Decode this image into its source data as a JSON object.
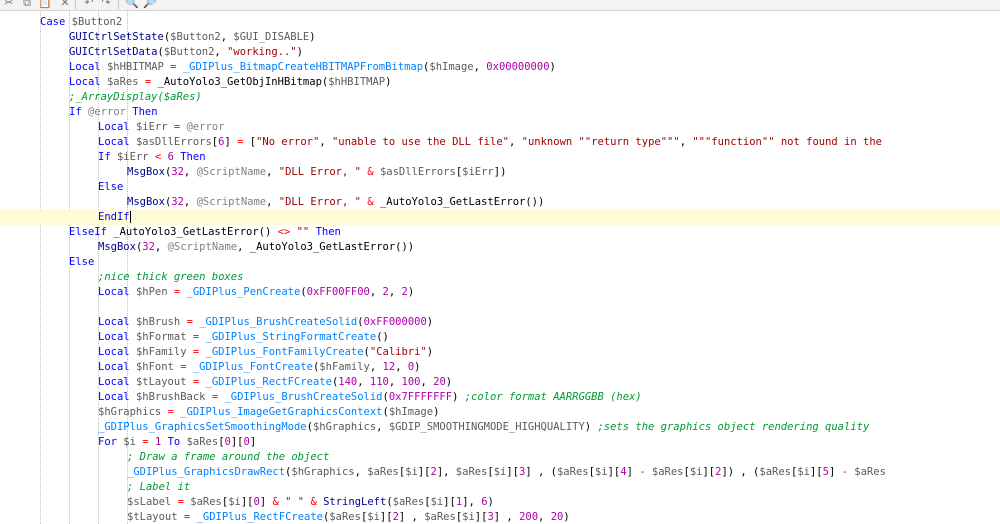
{
  "toolbar": {
    "icons": [
      "cut-icon",
      "copy-icon",
      "paste-icon",
      "delete-icon",
      "undo-icon",
      "redo-icon",
      "find-icon",
      "find-replace-icon"
    ],
    "glyphs": [
      "✂",
      "⧉",
      "📋",
      "✕",
      "↶",
      "↷",
      "🔍",
      "🔎"
    ]
  },
  "editor": {
    "lines": [
      [
        [
          "kw",
          "Case"
        ],
        [
          "t",
          " "
        ],
        [
          "var",
          "$Button2"
        ]
      ],
      [
        [
          "fn",
          "GUICtrlSetState"
        ],
        [
          "t",
          "("
        ],
        [
          "var",
          "$Button2"
        ],
        [
          "t",
          ", "
        ],
        [
          "var",
          "$GUI_DISABLE"
        ],
        [
          "t",
          ")"
        ]
      ],
      [
        [
          "fn",
          "GUICtrlSetData"
        ],
        [
          "t",
          "("
        ],
        [
          "var",
          "$Button2"
        ],
        [
          "t",
          ", "
        ],
        [
          "str",
          "\"working..\""
        ],
        [
          "t",
          ")"
        ]
      ],
      [
        [
          "kw",
          "Local"
        ],
        [
          "t",
          " "
        ],
        [
          "var",
          "$hHBITMAP"
        ],
        [
          "t",
          " "
        ],
        [
          "op",
          "="
        ],
        [
          "t",
          " "
        ],
        [
          "udf",
          "_GDIPlus_BitmapCreateHBITMAPFromBitmap"
        ],
        [
          "t",
          "("
        ],
        [
          "var",
          "$hImage"
        ],
        [
          "t",
          ", "
        ],
        [
          "num",
          "0x00000000"
        ],
        [
          "t",
          ")"
        ]
      ],
      [
        [
          "kw",
          "Local"
        ],
        [
          "t",
          " "
        ],
        [
          "var",
          "$aRes"
        ],
        [
          "t",
          " "
        ],
        [
          "op",
          "="
        ],
        [
          "t",
          " _AutoYolo3_GetObjInHBitmap("
        ],
        [
          "var",
          "$hHBITMAP"
        ],
        [
          "t",
          ")"
        ]
      ],
      [
        [
          "cm",
          ";_ArrayDisplay($aRes)"
        ]
      ],
      [
        [
          "kw",
          "If"
        ],
        [
          "t",
          " "
        ],
        [
          "mac",
          "@error"
        ],
        [
          "t",
          " "
        ],
        [
          "kw",
          "Then"
        ]
      ],
      [
        [
          "kw",
          "Local"
        ],
        [
          "t",
          " "
        ],
        [
          "var",
          "$iErr"
        ],
        [
          "t",
          " "
        ],
        [
          "op",
          "="
        ],
        [
          "t",
          " "
        ],
        [
          "mac",
          "@error"
        ]
      ],
      [
        [
          "kw",
          "Local"
        ],
        [
          "t",
          " "
        ],
        [
          "var",
          "$asDllErrors"
        ],
        [
          "t",
          "["
        ],
        [
          "num",
          "6"
        ],
        [
          "t",
          "] "
        ],
        [
          "op",
          "="
        ],
        [
          "t",
          " ["
        ],
        [
          "str",
          "\"No error\""
        ],
        [
          "t",
          ", "
        ],
        [
          "str",
          "\"unable to use the DLL file\""
        ],
        [
          "t",
          ", "
        ],
        [
          "str",
          "\"unknown \"\"return type\"\"\""
        ],
        [
          "t",
          ", "
        ],
        [
          "str",
          "\"\"\"function\"\" not found in the"
        ]
      ],
      [
        [
          "kw",
          "If"
        ],
        [
          "t",
          " "
        ],
        [
          "var",
          "$iErr"
        ],
        [
          "t",
          " "
        ],
        [
          "op",
          "<"
        ],
        [
          "t",
          " "
        ],
        [
          "num",
          "6"
        ],
        [
          "t",
          " "
        ],
        [
          "kw",
          "Then"
        ]
      ],
      [
        [
          "fn",
          "MsgBox"
        ],
        [
          "t",
          "("
        ],
        [
          "num",
          "32"
        ],
        [
          "t",
          ", "
        ],
        [
          "mac",
          "@ScriptName"
        ],
        [
          "t",
          ", "
        ],
        [
          "str",
          "\"DLL Error, \""
        ],
        [
          "t",
          " "
        ],
        [
          "op",
          "&"
        ],
        [
          "t",
          " "
        ],
        [
          "var",
          "$asDllErrors"
        ],
        [
          "t",
          "["
        ],
        [
          "var",
          "$iErr"
        ],
        [
          "t",
          "])"
        ]
      ],
      [
        [
          "kw",
          "Else"
        ]
      ],
      [
        [
          "fn",
          "MsgBox"
        ],
        [
          "t",
          "("
        ],
        [
          "num",
          "32"
        ],
        [
          "t",
          ", "
        ],
        [
          "mac",
          "@ScriptName"
        ],
        [
          "t",
          ", "
        ],
        [
          "str",
          "\"DLL Error, \""
        ],
        [
          "t",
          " "
        ],
        [
          "op",
          "&"
        ],
        [
          "t",
          " _AutoYolo3_GetLastError())"
        ]
      ],
      [
        [
          "kw",
          "EndIf"
        ]
      ],
      [
        [
          "kw",
          "ElseIf"
        ],
        [
          "t",
          " _AutoYolo3_GetLastError() "
        ],
        [
          "op",
          "<>"
        ],
        [
          "t",
          " "
        ],
        [
          "str",
          "\"\""
        ],
        [
          "t",
          " "
        ],
        [
          "kw",
          "Then"
        ]
      ],
      [
        [
          "fn",
          "MsgBox"
        ],
        [
          "t",
          "("
        ],
        [
          "num",
          "32"
        ],
        [
          "t",
          ", "
        ],
        [
          "mac",
          "@ScriptName"
        ],
        [
          "t",
          ", _AutoYolo3_GetLastError())"
        ]
      ],
      [
        [
          "kw",
          "Else"
        ]
      ],
      [
        [
          "cm",
          ";nice thick green boxes"
        ]
      ],
      [
        [
          "kw",
          "Local"
        ],
        [
          "t",
          " "
        ],
        [
          "var",
          "$hPen"
        ],
        [
          "t",
          " "
        ],
        [
          "op",
          "="
        ],
        [
          "t",
          " "
        ],
        [
          "udf",
          "_GDIPlus_PenCreate"
        ],
        [
          "t",
          "("
        ],
        [
          "num",
          "0xFF00FF00"
        ],
        [
          "t",
          ", "
        ],
        [
          "num",
          "2"
        ],
        [
          "t",
          ", "
        ],
        [
          "num",
          "2"
        ],
        [
          "t",
          ")"
        ]
      ],
      [],
      [
        [
          "kw",
          "Local"
        ],
        [
          "t",
          " "
        ],
        [
          "var",
          "$hBrush"
        ],
        [
          "t",
          " "
        ],
        [
          "op",
          "="
        ],
        [
          "t",
          " "
        ],
        [
          "udf",
          "_GDIPlus_BrushCreateSolid"
        ],
        [
          "t",
          "("
        ],
        [
          "num",
          "0xFF000000"
        ],
        [
          "t",
          ")"
        ]
      ],
      [
        [
          "kw",
          "Local"
        ],
        [
          "t",
          " "
        ],
        [
          "var",
          "$hFormat"
        ],
        [
          "t",
          " "
        ],
        [
          "op",
          "="
        ],
        [
          "t",
          " "
        ],
        [
          "udf",
          "_GDIPlus_StringFormatCreate"
        ],
        [
          "t",
          "()"
        ]
      ],
      [
        [
          "kw",
          "Local"
        ],
        [
          "t",
          " "
        ],
        [
          "var",
          "$hFamily"
        ],
        [
          "t",
          " "
        ],
        [
          "op",
          "="
        ],
        [
          "t",
          " "
        ],
        [
          "udf",
          "_GDIPlus_FontFamilyCreate"
        ],
        [
          "t",
          "("
        ],
        [
          "str",
          "\"Calibri\""
        ],
        [
          "t",
          ")"
        ]
      ],
      [
        [
          "kw",
          "Local"
        ],
        [
          "t",
          " "
        ],
        [
          "var",
          "$hFont"
        ],
        [
          "t",
          " "
        ],
        [
          "op",
          "="
        ],
        [
          "t",
          " "
        ],
        [
          "udf",
          "_GDIPlus_FontCreate"
        ],
        [
          "t",
          "("
        ],
        [
          "var",
          "$hFamily"
        ],
        [
          "t",
          ", "
        ],
        [
          "num",
          "12"
        ],
        [
          "t",
          ", "
        ],
        [
          "num",
          "0"
        ],
        [
          "t",
          ")"
        ]
      ],
      [
        [
          "kw",
          "Local"
        ],
        [
          "t",
          " "
        ],
        [
          "var",
          "$tLayout"
        ],
        [
          "t",
          " "
        ],
        [
          "op",
          "="
        ],
        [
          "t",
          " "
        ],
        [
          "udf",
          "_GDIPlus_RectFCreate"
        ],
        [
          "t",
          "("
        ],
        [
          "num",
          "140"
        ],
        [
          "t",
          ", "
        ],
        [
          "num",
          "110"
        ],
        [
          "t",
          ", "
        ],
        [
          "num",
          "100"
        ],
        [
          "t",
          ", "
        ],
        [
          "num",
          "20"
        ],
        [
          "t",
          ")"
        ]
      ],
      [
        [
          "kw",
          "Local"
        ],
        [
          "t",
          " "
        ],
        [
          "var",
          "$hBrushBack"
        ],
        [
          "t",
          " "
        ],
        [
          "op",
          "="
        ],
        [
          "t",
          " "
        ],
        [
          "udf",
          "_GDIPlus_BrushCreateSolid"
        ],
        [
          "t",
          "("
        ],
        [
          "num",
          "0x7FFFFFFF"
        ],
        [
          "t",
          ") "
        ],
        [
          "cm",
          ";color format AARRGGBB (hex)"
        ]
      ],
      [
        [
          "var",
          "$hGraphics"
        ],
        [
          "t",
          " "
        ],
        [
          "op",
          "="
        ],
        [
          "t",
          " "
        ],
        [
          "udf",
          "_GDIPlus_ImageGetGraphicsContext"
        ],
        [
          "t",
          "("
        ],
        [
          "var",
          "$hImage"
        ],
        [
          "t",
          ")"
        ]
      ],
      [
        [
          "udf",
          "_GDIPlus_GraphicsSetSmoothingMode"
        ],
        [
          "t",
          "("
        ],
        [
          "var",
          "$hGraphics"
        ],
        [
          "t",
          ", "
        ],
        [
          "var",
          "$GDIP_SMOOTHINGMODE_HIGHQUALITY"
        ],
        [
          "t",
          ") "
        ],
        [
          "cm",
          ";sets the graphics object rendering quality"
        ]
      ],
      [
        [
          "kw",
          "For"
        ],
        [
          "t",
          " "
        ],
        [
          "var",
          "$i"
        ],
        [
          "t",
          " "
        ],
        [
          "op",
          "="
        ],
        [
          "t",
          " "
        ],
        [
          "num",
          "1"
        ],
        [
          "t",
          " "
        ],
        [
          "kw",
          "To"
        ],
        [
          "t",
          " "
        ],
        [
          "var",
          "$aRes"
        ],
        [
          "t",
          "["
        ],
        [
          "num",
          "0"
        ],
        [
          "t",
          "]["
        ],
        [
          "num",
          "0"
        ],
        [
          "t",
          "]"
        ]
      ],
      [
        [
          "cm",
          "; Draw a frame around the object"
        ]
      ],
      [
        [
          "udf",
          "_GDIPlus_GraphicsDrawRect"
        ],
        [
          "t",
          "("
        ],
        [
          "var",
          "$hGraphics"
        ],
        [
          "t",
          ", "
        ],
        [
          "var",
          "$aRes"
        ],
        [
          "t",
          "["
        ],
        [
          "var",
          "$i"
        ],
        [
          "t",
          "]["
        ],
        [
          "num",
          "2"
        ],
        [
          "t",
          "], "
        ],
        [
          "var",
          "$aRes"
        ],
        [
          "t",
          "["
        ],
        [
          "var",
          "$i"
        ],
        [
          "t",
          "]["
        ],
        [
          "num",
          "3"
        ],
        [
          "t",
          "] , ("
        ],
        [
          "var",
          "$aRes"
        ],
        [
          "t",
          "["
        ],
        [
          "var",
          "$i"
        ],
        [
          "t",
          "]["
        ],
        [
          "num",
          "4"
        ],
        [
          "t",
          "] "
        ],
        [
          "op",
          "-"
        ],
        [
          "t",
          " "
        ],
        [
          "var",
          "$aRes"
        ],
        [
          "t",
          "["
        ],
        [
          "var",
          "$i"
        ],
        [
          "t",
          "]["
        ],
        [
          "num",
          "2"
        ],
        [
          "t",
          "]) , ("
        ],
        [
          "var",
          "$aRes"
        ],
        [
          "t",
          "["
        ],
        [
          "var",
          "$i"
        ],
        [
          "t",
          "]["
        ],
        [
          "num",
          "5"
        ],
        [
          "t",
          "] "
        ],
        [
          "op",
          "-"
        ],
        [
          "t",
          " "
        ],
        [
          "var",
          "$aRes"
        ]
      ],
      [
        [
          "cm",
          "; Label it"
        ]
      ],
      [
        [
          "var",
          "$sLabel"
        ],
        [
          "t",
          " "
        ],
        [
          "op",
          "="
        ],
        [
          "t",
          " "
        ],
        [
          "var",
          "$aRes"
        ],
        [
          "t",
          "["
        ],
        [
          "var",
          "$i"
        ],
        [
          "t",
          "]["
        ],
        [
          "num",
          "0"
        ],
        [
          "t",
          "] "
        ],
        [
          "op",
          "&"
        ],
        [
          "t",
          " "
        ],
        [
          "str",
          "\" \""
        ],
        [
          "t",
          " "
        ],
        [
          "op",
          "&"
        ],
        [
          "t",
          " "
        ],
        [
          "fn",
          "StringLeft"
        ],
        [
          "t",
          "("
        ],
        [
          "var",
          "$aRes"
        ],
        [
          "t",
          "["
        ],
        [
          "var",
          "$i"
        ],
        [
          "t",
          "]["
        ],
        [
          "num",
          "1"
        ],
        [
          "t",
          "], "
        ],
        [
          "num",
          "6"
        ],
        [
          "t",
          ")"
        ]
      ],
      [
        [
          "var",
          "$tLayout"
        ],
        [
          "t",
          " "
        ],
        [
          "op",
          "="
        ],
        [
          "t",
          " "
        ],
        [
          "udf",
          "_GDIPlus_RectFCreate"
        ],
        [
          "t",
          "("
        ],
        [
          "var",
          "$aRes"
        ],
        [
          "t",
          "["
        ],
        [
          "var",
          "$i"
        ],
        [
          "t",
          "]["
        ],
        [
          "num",
          "2"
        ],
        [
          "t",
          "] , "
        ],
        [
          "var",
          "$aRes"
        ],
        [
          "t",
          "["
        ],
        [
          "var",
          "$i"
        ],
        [
          "t",
          "]["
        ],
        [
          "num",
          "3"
        ],
        [
          "t",
          "] , "
        ],
        [
          "num",
          "200"
        ],
        [
          "t",
          ", "
        ],
        [
          "num",
          "20"
        ],
        [
          "t",
          ")"
        ]
      ]
    ],
    "current_line": 13
  }
}
